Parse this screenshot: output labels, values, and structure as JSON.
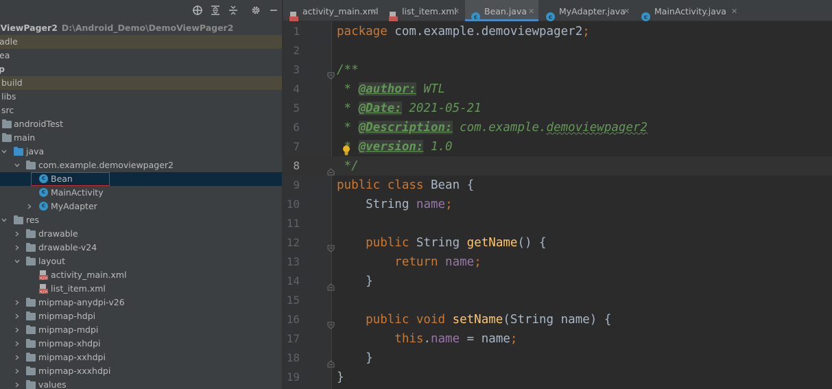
{
  "project": {
    "root_name": "oViewPager2",
    "root_path": "D:\\Android_Demo\\DemoViewPager2",
    "rows": [
      {
        "label": "adle"
      },
      {
        "label": "ea"
      },
      {
        "label": "p"
      },
      {
        "label": "build"
      },
      {
        "label": "libs"
      },
      {
        "label": "src"
      },
      {
        "label": "androidTest"
      },
      {
        "label": "main"
      },
      {
        "label": "java"
      },
      {
        "label": "com.example.demoviewpager2"
      },
      {
        "label": "Bean"
      },
      {
        "label": "MainActivity"
      },
      {
        "label": "MyAdapter"
      },
      {
        "label": "res"
      },
      {
        "label": "drawable"
      },
      {
        "label": "drawable-v24"
      },
      {
        "label": "layout"
      },
      {
        "label": "activity_main.xml"
      },
      {
        "label": "list_item.xml"
      },
      {
        "label": "mipmap-anydpi-v26"
      },
      {
        "label": "mipmap-hdpi"
      },
      {
        "label": "mipmap-mdpi"
      },
      {
        "label": "mipmap-xhdpi"
      },
      {
        "label": "mipmap-xxhdpi"
      },
      {
        "label": "mipmap-xxxhdpi"
      },
      {
        "label": "values"
      }
    ]
  },
  "tabs": [
    {
      "name": "activity_main.xml",
      "icon": "xml-file-icon",
      "active": false
    },
    {
      "name": "list_item.xml",
      "icon": "xml-file-icon",
      "active": false
    },
    {
      "name": "Bean.java",
      "icon": "java-class-icon",
      "active": true
    },
    {
      "name": "MyAdapter.java",
      "icon": "java-class-icon",
      "active": false
    },
    {
      "name": "MainActivity.java",
      "icon": "java-class-icon",
      "active": false
    }
  ],
  "tab_close_glyph": "✕",
  "editor": {
    "current_line": 8,
    "lines": [
      {
        "n": "1",
        "tokens": [
          [
            "kw",
            "package "
          ],
          [
            "pl",
            "com.example.demoviewpager2"
          ],
          [
            "kw",
            ";"
          ]
        ]
      },
      {
        "n": "2",
        "tokens": []
      },
      {
        "n": "3",
        "tokens": [
          [
            "cm",
            "/**"
          ]
        ]
      },
      {
        "n": "4",
        "tokens": [
          [
            "cm",
            " * "
          ],
          [
            "tag",
            "@author:"
          ],
          [
            "tv",
            " WTL"
          ]
        ]
      },
      {
        "n": "5",
        "tokens": [
          [
            "cm",
            " * "
          ],
          [
            "tag",
            "@Date:"
          ],
          [
            "tv",
            " 2021-05-21"
          ]
        ]
      },
      {
        "n": "6",
        "tokens": [
          [
            "cm",
            " * "
          ],
          [
            "tag",
            "@Description:"
          ],
          [
            "tv",
            " com.example."
          ],
          [
            "tv sq",
            "demoviewpager2"
          ]
        ]
      },
      {
        "n": "7",
        "tokens": [
          [
            "cm",
            " * "
          ],
          [
            "tag",
            "@version:"
          ],
          [
            "tv",
            " 1.0"
          ]
        ]
      },
      {
        "n": "8",
        "tokens": [
          [
            "cm",
            " */"
          ]
        ]
      },
      {
        "n": "9",
        "tokens": [
          [
            "kw",
            "public class "
          ],
          [
            "pl",
            "Bean {"
          ]
        ]
      },
      {
        "n": "10",
        "tokens": [
          [
            "pl",
            "    String "
          ],
          [
            "fld",
            "name"
          ],
          [
            "kw",
            ";"
          ]
        ]
      },
      {
        "n": "11",
        "tokens": []
      },
      {
        "n": "12",
        "tokens": [
          [
            "kw",
            "    public "
          ],
          [
            "pl",
            "String "
          ],
          [
            "fn",
            "getName"
          ],
          [
            "pl",
            "() {"
          ]
        ]
      },
      {
        "n": "13",
        "tokens": [
          [
            "kw",
            "        return "
          ],
          [
            "fld",
            "name"
          ],
          [
            "kw",
            ";"
          ]
        ]
      },
      {
        "n": "14",
        "tokens": [
          [
            "pl",
            "    }"
          ]
        ]
      },
      {
        "n": "15",
        "tokens": []
      },
      {
        "n": "16",
        "tokens": [
          [
            "kw",
            "    public void "
          ],
          [
            "fn",
            "setName"
          ],
          [
            "pl",
            "(String name) {"
          ]
        ]
      },
      {
        "n": "17",
        "tokens": [
          [
            "kw",
            "        this"
          ],
          [
            "pl",
            "."
          ],
          [
            "fld",
            "name"
          ],
          [
            "pl",
            " = name"
          ],
          [
            "kw",
            ";"
          ]
        ]
      },
      {
        "n": "18",
        "tokens": [
          [
            "pl",
            "    }"
          ]
        ]
      },
      {
        "n": "19",
        "tokens": [
          [
            "pl",
            "}"
          ]
        ]
      }
    ]
  },
  "colors": {
    "keyword": "#cc7832",
    "plain": "#a9b7c6",
    "doc_comment": "#629755",
    "field": "#9876aa",
    "method": "#ffc66d",
    "selection_border": "#d32a2a",
    "active_tab_underline": "#4a88c7"
  }
}
